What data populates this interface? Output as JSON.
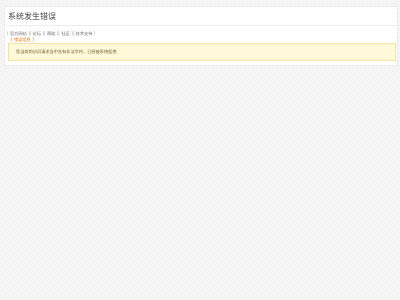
{
  "page": {
    "title": "系统发生错误"
  },
  "links": [
    {
      "label": "官方网站",
      "interactive": true
    },
    {
      "label": "论坛",
      "interactive": true
    },
    {
      "label": "帮助",
      "interactive": true
    },
    {
      "label": "社区",
      "interactive": true
    },
    {
      "label": "技术支持",
      "interactive": true
    }
  ],
  "info_tag": "错误信息",
  "notice": {
    "text": "您当前的访问请求当中含有非法字符，已经被系统拒绝"
  }
}
